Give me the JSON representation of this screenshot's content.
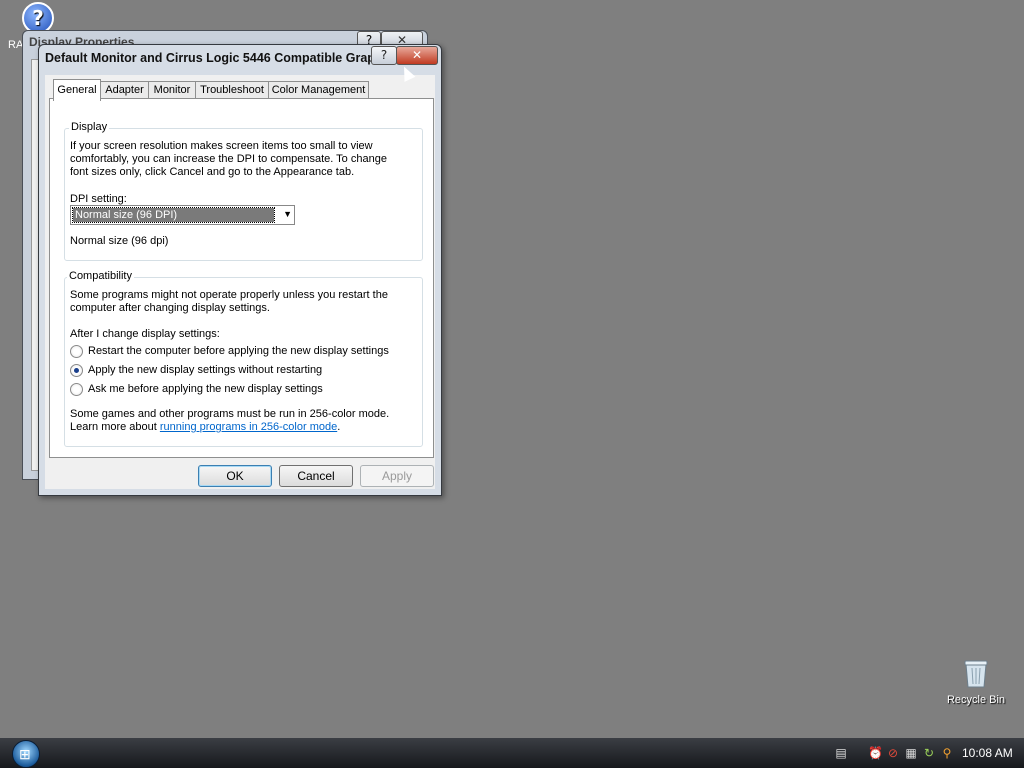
{
  "desktop": {
    "help_icon_label": "RA",
    "recycle_bin_label": "Recycle Bin"
  },
  "background_window": {
    "title": "Display Properties",
    "help_glyph": "?",
    "close_glyph": "✕"
  },
  "dialog": {
    "title": "Default Monitor and Cirrus Logic 5446 Compatible Grap...",
    "help_glyph": "?",
    "close_glyph": "✕",
    "tabs": [
      {
        "label": "General"
      },
      {
        "label": "Adapter"
      },
      {
        "label": "Monitor"
      },
      {
        "label": "Troubleshoot"
      },
      {
        "label": "Color Management"
      }
    ],
    "display_group": {
      "label": "Display",
      "description": "If your screen resolution makes screen items too small to view comfortably, you can increase the DPI to compensate.  To change font sizes only, click Cancel and go to the Appearance tab.",
      "dpi_label": "DPI setting:",
      "dpi_value": "Normal size (96 DPI)",
      "dpi_readout": "Normal size (96 dpi)"
    },
    "compat_group": {
      "label": "Compatibility",
      "description": "Some programs might not operate properly unless you restart the computer after changing display settings.",
      "after_label": "After I change display settings:",
      "options": [
        {
          "label": "Restart the computer before applying the new display settings",
          "checked": false
        },
        {
          "label": "Apply the new display settings without restarting",
          "checked": true
        },
        {
          "label": "Ask me before applying the new display settings",
          "checked": false
        }
      ],
      "note": "Some games and other programs must be run in 256-color mode.",
      "learn_prefix": "Learn more about ",
      "learn_link": "running programs in 256-color mode",
      "learn_suffix": "."
    },
    "buttons": {
      "ok": "OK",
      "cancel": "Cancel",
      "apply": "Apply"
    }
  },
  "taskbar": {
    "clock": "10:08 AM"
  }
}
